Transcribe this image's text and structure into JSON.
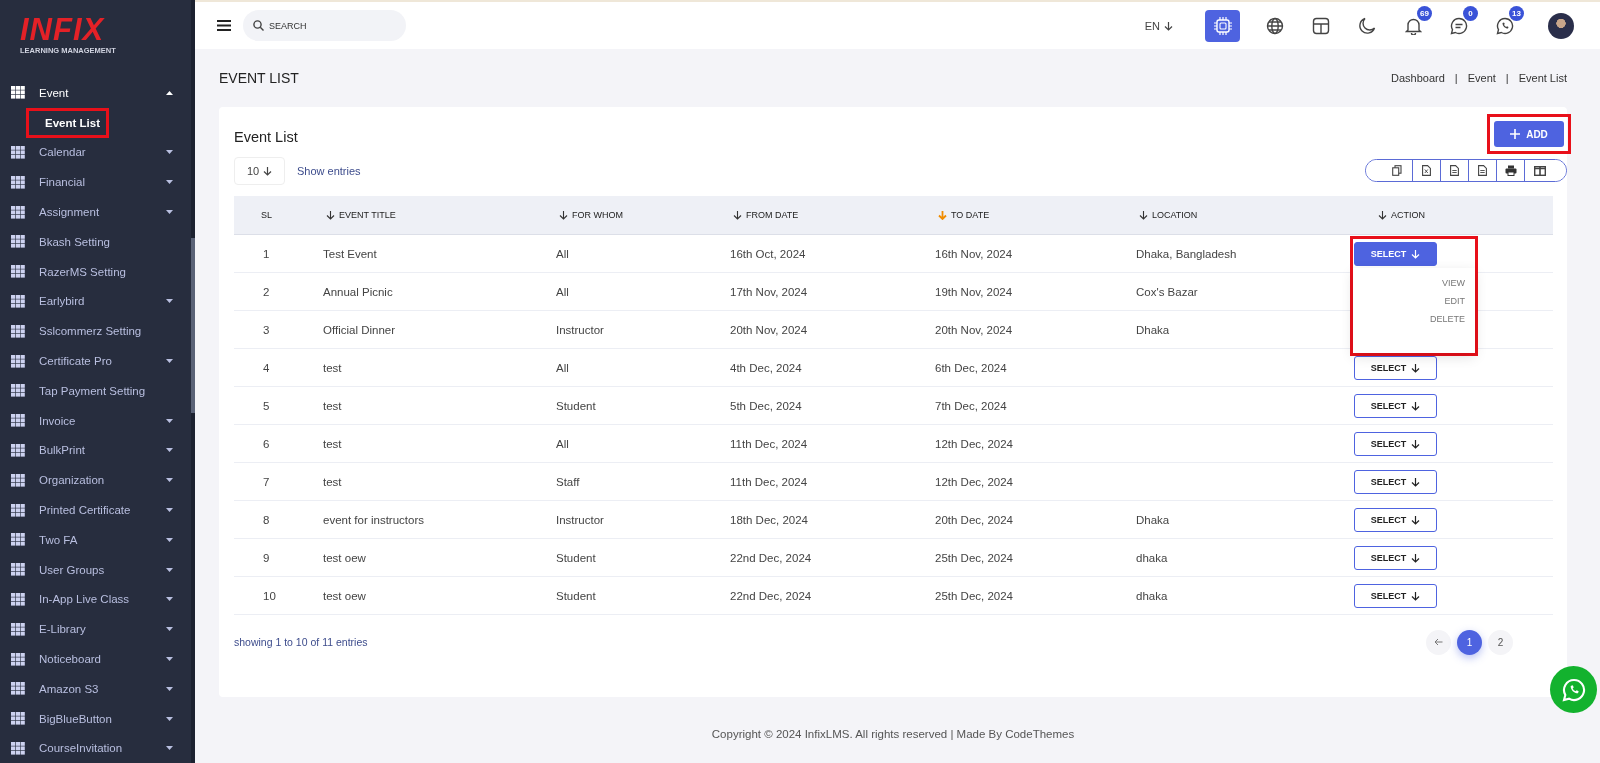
{
  "logo": {
    "brand": "INFIX",
    "tagline": "LEARNING MANAGEMENT"
  },
  "sidebar": {
    "items": [
      {
        "label": "Event",
        "has_children": true,
        "expanded": true,
        "children": [
          {
            "label": "Event List",
            "selected": true,
            "highlighted": true
          }
        ]
      },
      {
        "label": "Calendar",
        "has_children": true,
        "expanded": false
      },
      {
        "label": "Financial",
        "has_children": true,
        "expanded": false
      },
      {
        "label": "Assignment",
        "has_children": true,
        "expanded": false
      },
      {
        "label": "Bkash Setting",
        "has_children": false,
        "expanded": false
      },
      {
        "label": "RazerMS Setting",
        "has_children": false,
        "expanded": false
      },
      {
        "label": "Earlybird",
        "has_children": true,
        "expanded": false
      },
      {
        "label": "Sslcommerz Setting",
        "has_children": false,
        "expanded": false
      },
      {
        "label": "Certificate Pro",
        "has_children": true,
        "expanded": false
      },
      {
        "label": "Tap Payment Setting",
        "has_children": false,
        "expanded": false
      },
      {
        "label": "Invoice",
        "has_children": true,
        "expanded": false
      },
      {
        "label": "BulkPrint",
        "has_children": true,
        "expanded": false
      },
      {
        "label": "Organization",
        "has_children": true,
        "expanded": false
      },
      {
        "label": "Printed Certificate",
        "has_children": true,
        "expanded": false
      },
      {
        "label": "Two FA",
        "has_children": true,
        "expanded": false
      },
      {
        "label": "User Groups",
        "has_children": true,
        "expanded": false
      },
      {
        "label": "In-App Live Class",
        "has_children": true,
        "expanded": false
      },
      {
        "label": "E-Library",
        "has_children": true,
        "expanded": false
      },
      {
        "label": "Noticeboard",
        "has_children": true,
        "expanded": false
      },
      {
        "label": "Amazon S3",
        "has_children": true,
        "expanded": false
      },
      {
        "label": "BigBlueButton",
        "has_children": true,
        "expanded": false
      },
      {
        "label": "CourseInvitation",
        "has_children": true,
        "expanded": false
      }
    ]
  },
  "topbar": {
    "search": {
      "placeholder": "SEARCH"
    },
    "language": "EN",
    "badges": {
      "notifications": "69",
      "messages": "0",
      "chats": "13"
    }
  },
  "page": {
    "title": "EVENT LIST",
    "breadcrumb": [
      "Dashboard",
      "Event",
      "Event List"
    ],
    "separator": "|"
  },
  "card": {
    "title": "Event List",
    "add_button": {
      "label": "ADD",
      "highlighted": true
    },
    "entries": {
      "value": "10",
      "label": "Show entries"
    },
    "columns": [
      {
        "label": "SL",
        "sortable": false
      },
      {
        "label": "EVENT TITLE",
        "sortable": true,
        "sorted": false
      },
      {
        "label": "FOR WHOM",
        "sortable": true,
        "sorted": false
      },
      {
        "label": "FROM DATE",
        "sortable": true,
        "sorted": false
      },
      {
        "label": "TO DATE",
        "sortable": true,
        "sorted": true
      },
      {
        "label": "LOCATION",
        "sortable": true,
        "sorted": false
      },
      {
        "label": "ACTION",
        "sortable": true,
        "sorted": false
      }
    ],
    "rows": [
      {
        "cells": [
          "1",
          "Test Event",
          "All",
          "16th Oct, 2024",
          "16th Nov, 2024",
          "Dhaka, Bangladesh"
        ],
        "action": "SELECT",
        "open": true
      },
      {
        "cells": [
          "2",
          "Annual Picnic",
          "All",
          "17th Nov, 2024",
          "19th Nov, 2024",
          "Cox's Bazar"
        ]
      },
      {
        "cells": [
          "3",
          "Official Dinner",
          "Instructor",
          "20th Nov, 2024",
          "20th Nov, 2024",
          "Dhaka"
        ]
      },
      {
        "cells": [
          "4",
          "test",
          "All",
          "4th Dec, 2024",
          "6th Dec, 2024",
          ""
        ],
        "action": "SELECT",
        "open": false
      },
      {
        "cells": [
          "5",
          "test",
          "Student",
          "5th Dec, 2024",
          "7th Dec, 2024",
          ""
        ],
        "action": "SELECT",
        "open": false
      },
      {
        "cells": [
          "6",
          "test",
          "All",
          "11th Dec, 2024",
          "12th Dec, 2024",
          ""
        ],
        "action": "SELECT",
        "open": false
      },
      {
        "cells": [
          "7",
          "test",
          "Staff",
          "11th Dec, 2024",
          "12th Dec, 2024",
          ""
        ],
        "action": "SELECT",
        "open": false
      },
      {
        "cells": [
          "8",
          "event for instructors",
          "Instructor",
          "18th Dec, 2024",
          "20th Dec, 2024",
          "Dhaka"
        ],
        "action": "SELECT",
        "open": false
      },
      {
        "cells": [
          "9",
          "test oew",
          "Student",
          "22nd Dec, 2024",
          "25th Dec, 2024",
          "dhaka"
        ],
        "action": "SELECT",
        "open": false
      },
      {
        "cells": [
          "10",
          "test oew",
          "Student",
          "22nd Dec, 2024",
          "25th Dec, 2024",
          "dhaka"
        ],
        "action": "SELECT",
        "open": false
      }
    ],
    "action_menu": {
      "items": [
        "VIEW",
        "EDIT",
        "DELETE"
      ],
      "highlighted": true
    },
    "summary": "showing 1 to 10 of 11 entries",
    "pages": [
      {
        "label": "1",
        "selected": true
      },
      {
        "label": "2",
        "selected": false
      }
    ]
  },
  "footer": "Copyright © 2024 InfixLMS. All rights reserved | Made By CodeThemes"
}
